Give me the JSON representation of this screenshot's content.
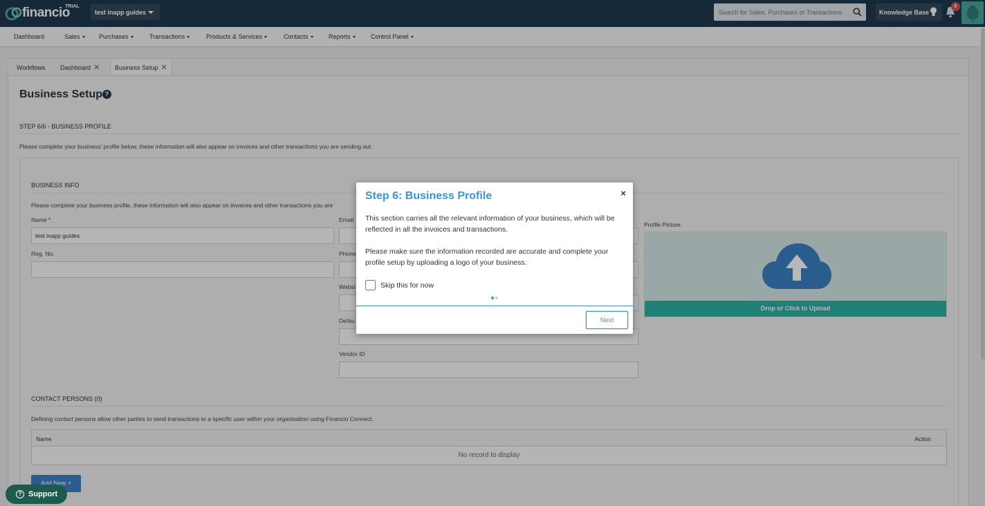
{
  "brand": {
    "name": "financio",
    "badge": "TRIAL"
  },
  "company_selector": {
    "value": "test inapp guides"
  },
  "search": {
    "placeholder": "Search for Sales, Purchases or Transactions"
  },
  "knowledge_base": {
    "label": "Knowledge Base"
  },
  "notifications": {
    "count": "6"
  },
  "nav": {
    "items": [
      {
        "label": "Dashboard",
        "dropdown": false
      },
      {
        "label": "Sales",
        "dropdown": true
      },
      {
        "label": "Purchases",
        "dropdown": true
      },
      {
        "label": "Transactions",
        "dropdown": true
      },
      {
        "label": "Products & Services",
        "dropdown": true
      },
      {
        "label": "Contacts",
        "dropdown": true
      },
      {
        "label": "Reports",
        "dropdown": true
      },
      {
        "label": "Control Panel",
        "dropdown": true
      }
    ]
  },
  "tabs": [
    {
      "label": "Workflows",
      "closable": false
    },
    {
      "label": "Dashboard",
      "closable": true
    },
    {
      "label": "Business Setup",
      "closable": true,
      "active": true
    }
  ],
  "page": {
    "title": "Business Setup",
    "step_label": "STEP 6/6 - BUSINESS PROFILE",
    "step_desc": "Please complete your business' profile below, these information will also appear on invoices and other transactions you are sending out."
  },
  "business_info": {
    "title": "BUSINESS INFO",
    "desc": "Please complete your business profile, these information will also appear on invoices and other transactions you are",
    "name_label": "Name *",
    "name_value": "test inapp guides",
    "reg_label": "Reg. No.",
    "email_label": "Email",
    "phone_label": "Phone",
    "website_label": "Websi",
    "default_label": "Defau",
    "vendor_label": "Vendor ID",
    "profile_picture_label": "Profile Picture",
    "upload_label": "Drop or Click to Upload"
  },
  "contact_persons": {
    "title": "CONTACT PERSONS (0)",
    "desc": "Defining contact persons allow other parties to send transactions to a specific user within your organisation using Financio Connect.",
    "col_name": "Name",
    "col_action": "Action",
    "empty": "No record to display",
    "add_label": "Add New +"
  },
  "modal": {
    "title": "Step 6: Business Profile",
    "close": "×",
    "p1": "This section carries all the relevant information of your business, which will be reflected in all the invoices and transactions.",
    "p2": "Please make sure the information recorded are accurate and complete your profile setup by uploading a logo of your business.",
    "skip_label": "Skip this for now",
    "next_label": "Next"
  },
  "support": {
    "label": "Support"
  },
  "colors": {
    "topbar": "#1f3a4f",
    "accent": "#3b94d9",
    "teal": "#2bb3a4",
    "badge": "#d9534f"
  }
}
